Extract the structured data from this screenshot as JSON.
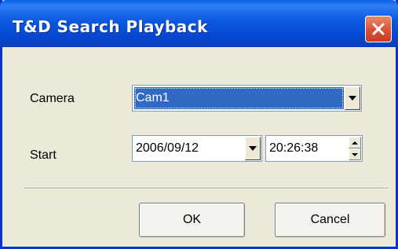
{
  "window": {
    "title": "T&D Search Playback"
  },
  "close_icon": "close-icon",
  "camera": {
    "label": "Camera",
    "value": "Cam1"
  },
  "start": {
    "label": "Start",
    "date": "2006/09/12",
    "time": "20:26:38"
  },
  "buttons": {
    "ok": "OK",
    "cancel": "Cancel"
  },
  "colors": {
    "titlebar": "#0b58e0",
    "close": "#d8553a",
    "selection": "#316ac5",
    "background": "#ece9d8"
  }
}
